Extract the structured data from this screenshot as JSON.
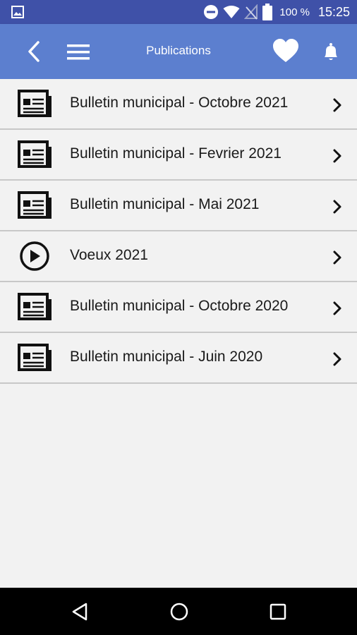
{
  "status_bar": {
    "battery_text": "100 %",
    "time": "15:25",
    "icons": [
      "image-icon",
      "do-not-disturb-icon",
      "wifi-icon",
      "no-signal-icon",
      "battery-icon"
    ]
  },
  "app_bar": {
    "title": "Publications",
    "color": "#5c7fcf",
    "icons": [
      "back-icon",
      "menu-icon",
      "heart-icon",
      "bell-icon"
    ]
  },
  "publications": [
    {
      "label": "Bulletin municipal - Octobre 2021",
      "icon": "newspaper-icon"
    },
    {
      "label": "Bulletin municipal - Fevrier 2021",
      "icon": "newspaper-icon"
    },
    {
      "label": "Bulletin municipal - Mai 2021",
      "icon": "newspaper-icon"
    },
    {
      "label": "Voeux 2021",
      "icon": "play-icon"
    },
    {
      "label": "Bulletin municipal - Octobre 2020",
      "icon": "newspaper-icon"
    },
    {
      "label": "Bulletin municipal - Juin 2020",
      "icon": "newspaper-icon"
    }
  ],
  "nav_bar": {
    "icons": [
      "nav-back-icon",
      "nav-home-icon",
      "nav-recent-icon"
    ]
  }
}
